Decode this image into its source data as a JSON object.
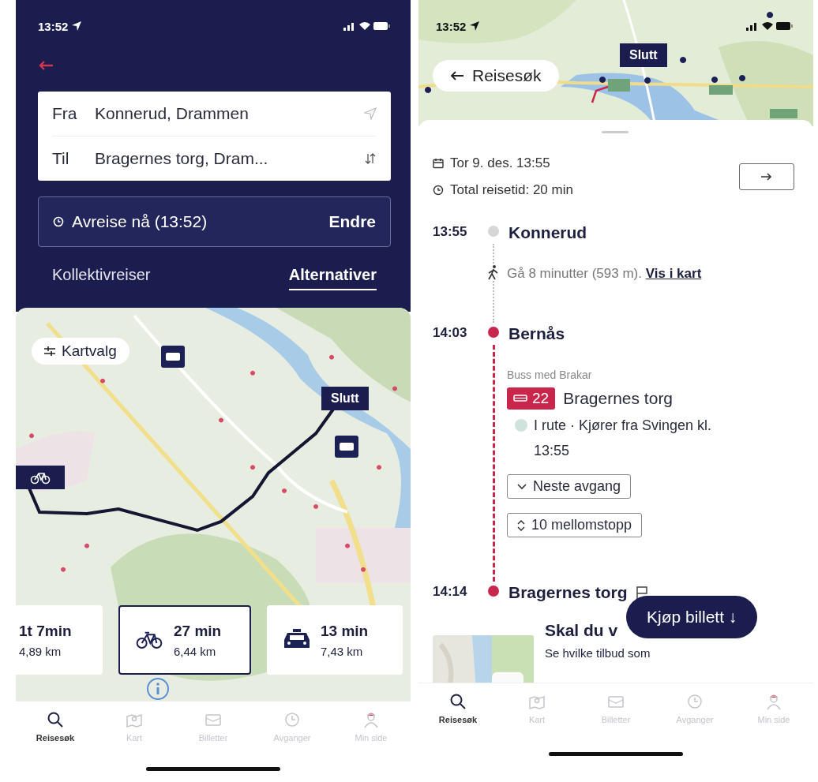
{
  "left": {
    "status_bar": {
      "time": "13:52"
    },
    "from": {
      "label": "Fra",
      "value": "Konnerud, Drammen"
    },
    "to": {
      "label": "Til",
      "value": "Bragernes torg, Dram..."
    },
    "departure": {
      "text": "Avreise nå (13:52)",
      "action": "Endre"
    },
    "tabs": [
      {
        "label": "Kollektivreiser",
        "selected": false
      },
      {
        "label": "Alternativer",
        "selected": true
      }
    ],
    "map": {
      "filter_label": "Kartvalg",
      "end_marker": "Slutt"
    },
    "options": [
      {
        "kind": "walk",
        "duration": "1t 7min",
        "distance": "4,89 km",
        "selected": false
      },
      {
        "kind": "bike",
        "duration": "27 min",
        "distance": "6,44 km",
        "selected": true
      },
      {
        "kind": "taxi",
        "duration": "13 min",
        "distance": "7,43 km",
        "selected": false
      }
    ],
    "tab_bar": [
      {
        "kind": "search",
        "label": "Reisesøk",
        "selected": true
      },
      {
        "kind": "map",
        "label": "Kart",
        "selected": false
      },
      {
        "kind": "ticket",
        "label": "Billetter",
        "selected": false
      },
      {
        "kind": "clock",
        "label": "Avganger",
        "selected": false
      },
      {
        "kind": "person",
        "label": "Min side",
        "selected": false
      }
    ]
  },
  "right": {
    "status_bar": {
      "time": "13:52"
    },
    "map": {
      "back_label": "Reisesøk",
      "end_marker": "Slutt"
    },
    "date": "Tor 9. des. 13:55",
    "total": "Total reisetid: 20 min",
    "timeline": [
      {
        "kind": "origin",
        "time": "13:55",
        "name": "Konnerud"
      },
      {
        "kind": "walk",
        "text": "Gå 8 minutter (593 m).",
        "link": "Vis i kart"
      },
      {
        "kind": "board",
        "time": "14:03",
        "name": "Bernås"
      },
      {
        "kind": "bus",
        "operator": "Buss med Brakar",
        "line": "22",
        "destination": "Bragernes torg",
        "status": "I rute · Kjører fra Svingen kl. 13:55",
        "buttons": [
          {
            "kind": "expand",
            "label": "Neste avgang"
          },
          {
            "kind": "stops",
            "label": "10 mellomstopp"
          }
        ]
      },
      {
        "kind": "destination",
        "time": "14:14",
        "name": "Bragernes torg"
      }
    ],
    "promo": {
      "title": "Skal du v",
      "text": "Se hvilke tilbud som"
    },
    "buy_button": "Kjøp billett ↓",
    "tab_bar": [
      {
        "kind": "search",
        "label": "Reisesøk",
        "selected": true
      },
      {
        "kind": "map",
        "label": "Kart",
        "selected": false
      },
      {
        "kind": "ticket",
        "label": "Billetter",
        "selected": false
      },
      {
        "kind": "clock",
        "label": "Avganger",
        "selected": false
      },
      {
        "kind": "person",
        "label": "Min side",
        "selected": false
      }
    ]
  }
}
